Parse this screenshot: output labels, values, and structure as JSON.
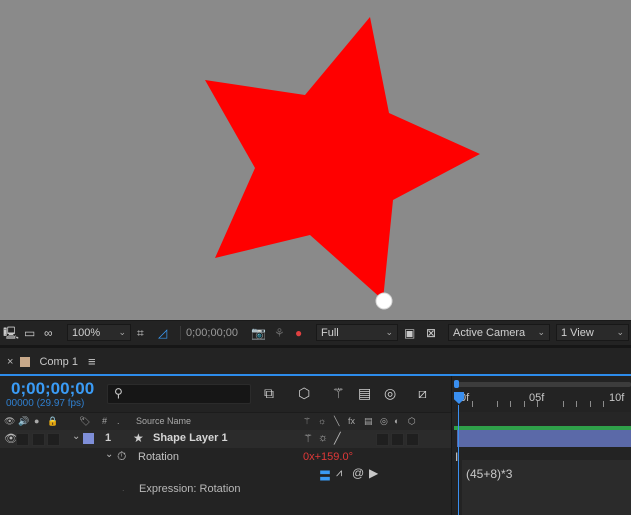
{
  "viewer": {
    "star_color": "#ff0000",
    "background_color": "#8a8a8a",
    "toolbar": {
      "zoom": "100%",
      "timecode": "0;00;00;00",
      "resolution": "Full",
      "view": "Active Camera",
      "layout": "1 View"
    }
  },
  "panel": {
    "tab_label": "Comp 1",
    "menu_icon": "≡"
  },
  "timeline": {
    "timecode": "0;00;00;00",
    "fps": "00000 (29.97 fps)",
    "search_icon": "⚲",
    "ruler_labels": [
      "0f",
      "05f",
      "10f"
    ],
    "columns": {
      "num": "#",
      "source_name": "Source Name"
    },
    "layer": {
      "number": "1",
      "name": "Shape Layer 1",
      "color": "#7f8fd9"
    },
    "property": {
      "name": "Rotation",
      "value_revolutions": "0x",
      "value_degrees": "+159.0°",
      "value_color": "#e03838"
    },
    "expression": {
      "label": "Expression: Rotation",
      "text": "(45+8)*3"
    },
    "colors": {
      "accent": "#3a9bf5",
      "work_area": "#2fa04a",
      "layer_bar": "#5b69a8"
    }
  }
}
